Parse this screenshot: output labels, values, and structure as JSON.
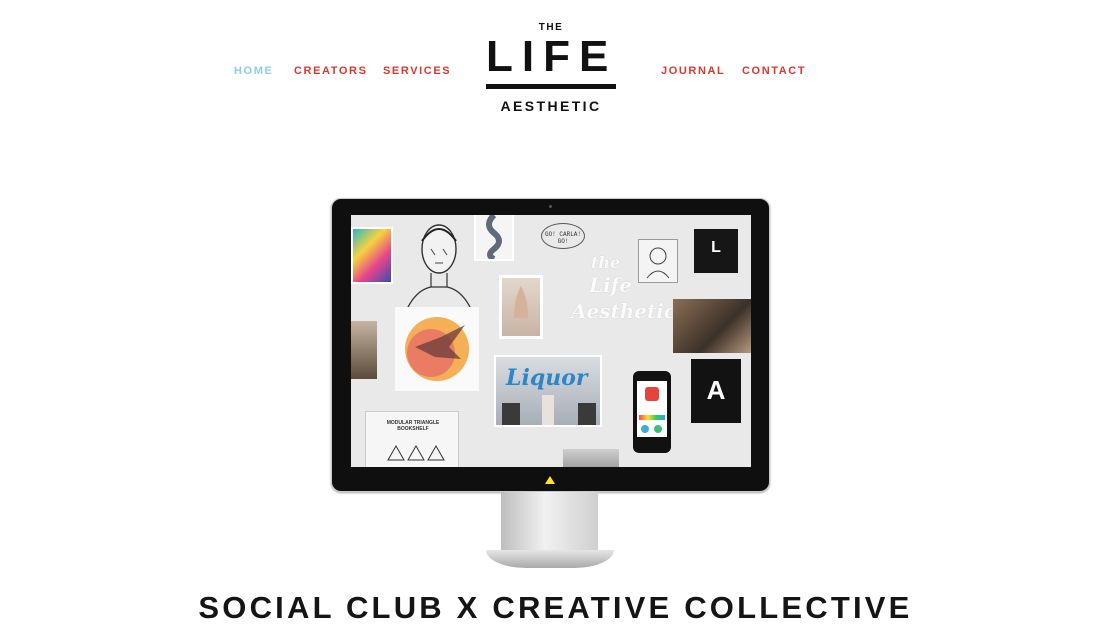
{
  "nav": {
    "home": "HOME",
    "creators": "CREATORS",
    "services": "SERVICES",
    "journal": "JOURNAL",
    "contact": "CONTACT"
  },
  "logo": {
    "the": "THE",
    "life": "LIFE",
    "aesthetic": "AESTHETIC"
  },
  "moodboard": {
    "speech_bubble": "GO! CARLA! GO!",
    "script_logo_line1": "the",
    "script_logo_line2": "Life",
    "script_logo_line3": "Aesthetic",
    "neon_sign": "Liquor",
    "card_title": "MODULAR TRIANGLE BOOKSHELF",
    "tile_letter": "L",
    "tote_letter": "A"
  },
  "hero": {
    "tagline": "SOCIAL CLUB X CREATIVE COLLECTIVE"
  },
  "colors": {
    "nav_active": "#8ccfe6",
    "nav_default": "#d7392b",
    "text_dark": "#151515",
    "power_led": "#ffe21a"
  }
}
